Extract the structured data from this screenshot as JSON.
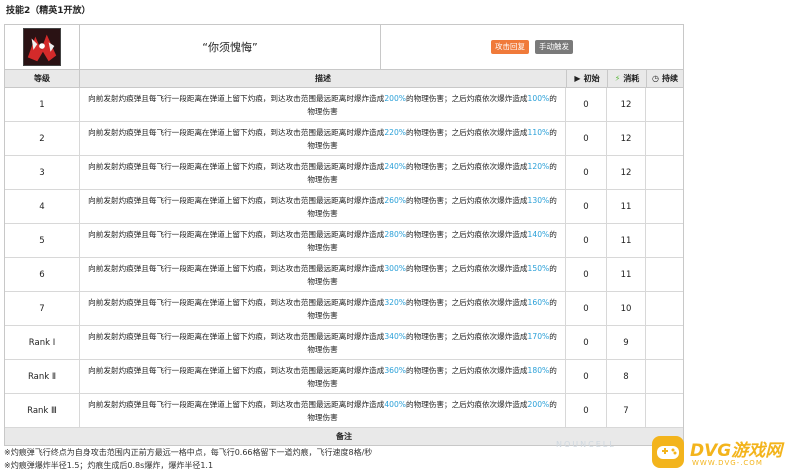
{
  "heading": "技能2（精英1开放）",
  "skill": {
    "icon": "skill-red-black-icon",
    "name": "“你须愧悔”",
    "tags": [
      "攻击回复",
      "手动触发"
    ],
    "tag_colors": [
      "#f07a3a",
      "#7a7a7a"
    ]
  },
  "columns": {
    "level": "等级",
    "desc": "描述",
    "init": "初始",
    "cost": "消耗",
    "dur": "持续",
    "init_icon": "play-icon",
    "cost_icon": "lightning-icon",
    "dur_icon": "clock-icon"
  },
  "desc_parts": {
    "p1": "向前发射灼痕弹且每飞行一段距离在弹道上留下灼痕，到达攻击范围最远距离时爆炸造成",
    "p2": "的物理伤害；之后灼痕依次爆炸造成",
    "p3": "的物理伤害"
  },
  "rows": [
    {
      "level": "1",
      "a": "200%",
      "b": "100%",
      "init": "0",
      "cost": "12",
      "dur": ""
    },
    {
      "level": "2",
      "a": "220%",
      "b": "110%",
      "init": "0",
      "cost": "12",
      "dur": ""
    },
    {
      "level": "3",
      "a": "240%",
      "b": "120%",
      "init": "0",
      "cost": "12",
      "dur": ""
    },
    {
      "level": "4",
      "a": "260%",
      "b": "130%",
      "init": "0",
      "cost": "11",
      "dur": ""
    },
    {
      "level": "5",
      "a": "280%",
      "b": "140%",
      "init": "0",
      "cost": "11",
      "dur": ""
    },
    {
      "level": "6",
      "a": "300%",
      "b": "150%",
      "init": "0",
      "cost": "11",
      "dur": ""
    },
    {
      "level": "7",
      "a": "320%",
      "b": "160%",
      "init": "0",
      "cost": "10",
      "dur": ""
    },
    {
      "level": "Rank Ⅰ",
      "a": "340%",
      "b": "170%",
      "init": "0",
      "cost": "9",
      "dur": ""
    },
    {
      "level": "Rank Ⅱ",
      "a": "360%",
      "b": "180%",
      "init": "0",
      "cost": "8",
      "dur": ""
    },
    {
      "level": "Rank Ⅲ",
      "a": "400%",
      "b": "200%",
      "init": "0",
      "cost": "7",
      "dur": ""
    }
  ],
  "notes_head": "备注",
  "notes": [
    "※灼痕弹飞行终点为自身攻击范围内正前方最远一格中点，每飞行0.66格留下一道灼痕，飞行速度8格/秒",
    "※灼痕弹爆炸半径1.5；灼痕生成后0.8s爆炸，爆炸半径1.1"
  ],
  "watermark": "DVG游戏网",
  "watermark_sub": "WWW.DVG-.COM",
  "brand_color": "#f3b41c",
  "accent_color": "#2aa0d8"
}
